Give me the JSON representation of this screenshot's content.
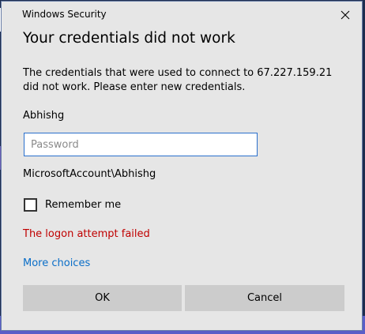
{
  "window": {
    "title": "Windows Security",
    "close_icon": "close-icon"
  },
  "heading": "Your credentials did not work",
  "message": "The credentials that were used to connect to 67.227.159.21 did not work. Please enter new credentials.",
  "username": "Abhishg",
  "password": {
    "value": "",
    "placeholder": "Password"
  },
  "domain_account": "MicrosoftAccount\\Abhishg",
  "remember": {
    "label": "Remember me",
    "checked": false
  },
  "error_text": "The logon attempt failed",
  "more_choices_label": "More choices",
  "buttons": {
    "ok_label": "OK",
    "cancel_label": "Cancel"
  },
  "colors": {
    "error": "#c00000",
    "link": "#0a6ec8",
    "input_border": "#2a6fcc",
    "dialog_bg": "#e6e6e6",
    "button_bg": "#cccccc"
  }
}
